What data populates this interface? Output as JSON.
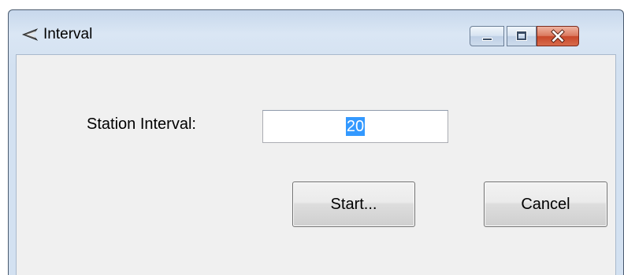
{
  "window": {
    "title": "Interval",
    "icon": "app-logo-icon",
    "controls": {
      "minimize": "minimize-icon",
      "maximize": "maximize-icon",
      "close": "close-icon"
    }
  },
  "form": {
    "station_interval_label": "Station Interval:",
    "station_interval_value": "20"
  },
  "buttons": {
    "start_label": "Start...",
    "cancel_label": "Cancel"
  },
  "colors": {
    "selection": "#3399ff",
    "close_button": "#c8482a",
    "frame": "#d3e1f1"
  }
}
